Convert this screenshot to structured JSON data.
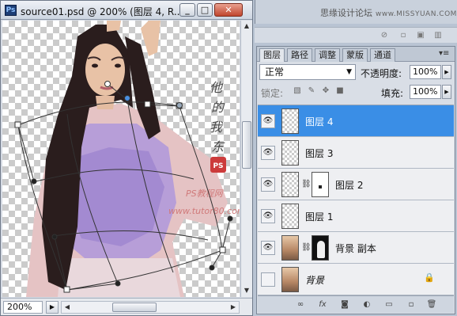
{
  "document": {
    "app_icon": "Ps",
    "title": "source01.psd @ 200% (图层 4, R...",
    "buttons": {
      "minimize": "_",
      "maximize": "□",
      "close": "✕"
    },
    "zoom": "200%",
    "canvas_text": {
      "calligraphy": "他\n的\n我\n东",
      "seal": "PS",
      "watermark_line1": "PS教程网",
      "watermark_line2": "www.tutor80.com"
    }
  },
  "watermark": {
    "site_name": "思缘设计论坛",
    "site_url": "www.MISSYUAN.COM"
  },
  "layers_panel": {
    "tabs": [
      "图层",
      "路径",
      "调整",
      "蒙版",
      "通道"
    ],
    "active_tab": "图层",
    "blend_mode": "正常",
    "opacity_label": "不透明度:",
    "opacity_value": "100%",
    "lock_label": "锁定:",
    "fill_label": "填充:",
    "fill_value": "100%",
    "layers": [
      {
        "name": "图层 4",
        "selected": true,
        "visible": true
      },
      {
        "name": "图层 3",
        "selected": false,
        "visible": true
      },
      {
        "name": "图层 2",
        "selected": false,
        "visible": true
      },
      {
        "name": "图层 1",
        "selected": false,
        "visible": true
      },
      {
        "name": "背景 副本",
        "selected": false,
        "visible": true
      },
      {
        "name": "背景",
        "selected": false,
        "visible": false,
        "locked": true
      }
    ]
  },
  "colors": {
    "selection": "#3a8ee6",
    "panel_bg": "#d9dee6"
  }
}
